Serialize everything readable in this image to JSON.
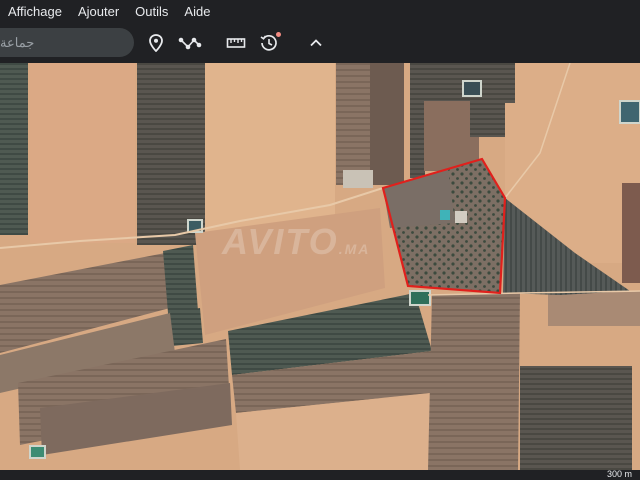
{
  "menu": {
    "items": [
      {
        "label": "Affichage"
      },
      {
        "label": "Ajouter"
      },
      {
        "label": "Outils"
      },
      {
        "label": "Aide"
      }
    ]
  },
  "toolbar": {
    "search_placeholder": "جماعة",
    "icons": [
      "placemark-icon",
      "path-icon",
      "ruler-icon",
      "historical-imagery-icon",
      "collapse-icon"
    ]
  },
  "map": {
    "watermark": "AVITO",
    "watermark_suffix": ".MA",
    "boundary_color": "#e0201c"
  },
  "footer": {
    "scale": "300 m"
  }
}
